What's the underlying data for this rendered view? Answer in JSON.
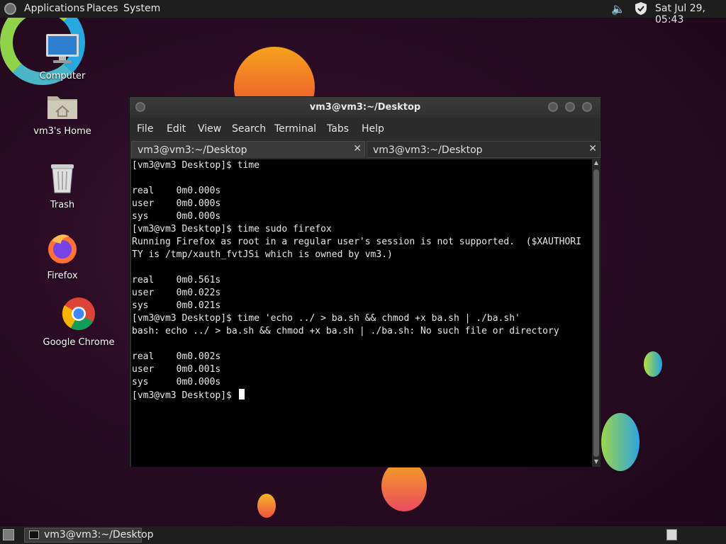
{
  "top_panel": {
    "menus": [
      "Applications",
      "Places",
      "System"
    ],
    "clock": "Sat Jul 29, 05:43",
    "icons": [
      "system-logo-icon",
      "volume-icon",
      "shield-icon"
    ]
  },
  "desktop_icons": [
    {
      "label": "Computer",
      "icon": "computer-icon"
    },
    {
      "label": "vm3's Home",
      "icon": "home-folder-icon"
    },
    {
      "label": "Trash",
      "icon": "trash-icon"
    },
    {
      "label": "Firefox",
      "icon": "firefox-icon"
    },
    {
      "label": "Google Chrome",
      "icon": "chrome-icon"
    }
  ],
  "terminal": {
    "title": "vm3@vm3:~/Desktop",
    "menu": [
      "File",
      "Edit",
      "View",
      "Search",
      "Terminal",
      "Tabs",
      "Help"
    ],
    "tabs": [
      {
        "label": "vm3@vm3:~/Desktop",
        "active": true
      },
      {
        "label": "vm3@vm3:~/Desktop",
        "active": false
      }
    ],
    "lines": [
      "[vm3@vm3 Desktop]$ time",
      "",
      "real    0m0.000s",
      "user    0m0.000s",
      "sys     0m0.000s",
      "[vm3@vm3 Desktop]$ time sudo firefox",
      "Running Firefox as root in a regular user's session is not supported.  ($XAUTHORI",
      "TY is /tmp/xauth_fvtJSi which is owned by vm3.)",
      "",
      "real    0m0.561s",
      "user    0m0.022s",
      "sys     0m0.021s",
      "[vm3@vm3 Desktop]$ time 'echo ../ > ba.sh && chmod +x ba.sh | ./ba.sh'",
      "bash: echo ../ > ba.sh && chmod +x ba.sh | ./ba.sh: No such file or directory",
      "",
      "real    0m0.002s",
      "user    0m0.001s",
      "sys     0m0.000s"
    ],
    "prompt": "[vm3@vm3 Desktop]$ "
  },
  "bottom_panel": {
    "taskbar_item": "vm3@vm3:~/Desktop"
  },
  "colors": {
    "panel_bg": "#1e1e1e",
    "terminal_bg": "#000000",
    "terminal_fg": "#e8e8e8",
    "desktop_bg": "#2a0c24"
  }
}
